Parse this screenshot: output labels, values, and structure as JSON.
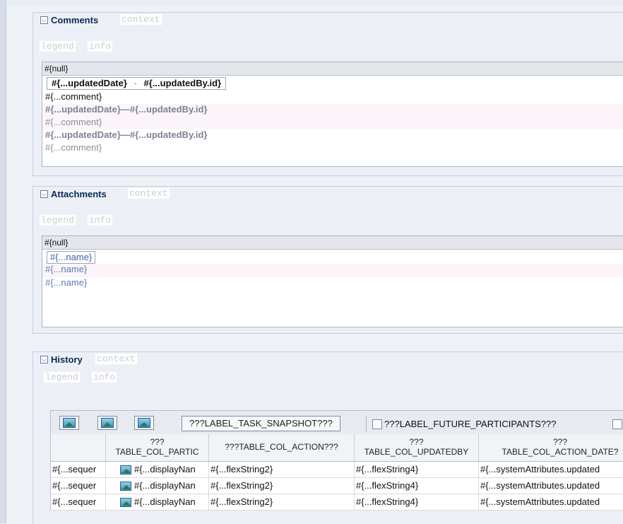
{
  "comments": {
    "title": "Comments",
    "context_tag": "context",
    "legend_tag": "legend",
    "info_tag": "info",
    "table_header": "#{null}",
    "selected_row": {
      "date": "#{...updatedDate}",
      "separator": "-",
      "by": "#{...updatedBy.id}"
    },
    "selected_comment": "#{...comment}",
    "rows": [
      {
        "date_by": "#{...updatedDate}—#{...updatedBy.id}",
        "comment": "#{...comment}"
      },
      {
        "date_by": "#{...updatedDate}—#{...updatedBy.id}",
        "comment": "#{...comment}"
      }
    ]
  },
  "attachments": {
    "title": "Attachments",
    "context_tag": "context",
    "legend_tag": "legend",
    "info_tag": "info",
    "table_header": "#{null}",
    "rows": [
      "#{...name}",
      "#{...name}",
      "#{...name}"
    ]
  },
  "history": {
    "title": "History",
    "context_tag": "context",
    "legend_tag": "legend",
    "info_tag": "info",
    "toolbar": {
      "icons": [
        "image-icon",
        "image-icon",
        "image-icon"
      ],
      "snapshot_label": "???LABEL_TASK_SNAPSHOT???",
      "future_participants_label": "???LABEL_FUTURE_PARTICIPANTS???"
    },
    "columns": [
      {
        "l1": "",
        "l2": ""
      },
      {
        "l1": "???",
        "l2": "TABLE_COL_PARTIC"
      },
      {
        "l1": "",
        "l2": "???TABLE_COL_ACTION???"
      },
      {
        "l1": "???",
        "l2": "TABLE_COL_UPDATEDBY"
      },
      {
        "l1": "???",
        "l2": "TABLE_COL_ACTION_DATE?"
      }
    ],
    "rows": [
      [
        "#{...sequer",
        "#{...displayNan",
        "#{...flexString2}",
        "#{...flexString4}",
        "#{...systemAttributes.updated"
      ],
      [
        "#{...sequer",
        "#{...displayNan",
        "#{...flexString2}",
        "#{...flexString4}",
        "#{...systemAttributes.updated"
      ],
      [
        "#{...sequer",
        "#{...displayNan",
        "#{...flexString2}",
        "#{...flexString4}",
        "#{...systemAttributes.updated"
      ]
    ]
  },
  "colors": {
    "panel_bg": "#ecf0f6",
    "title": "#0b2a55",
    "link": "#3a63a8"
  }
}
